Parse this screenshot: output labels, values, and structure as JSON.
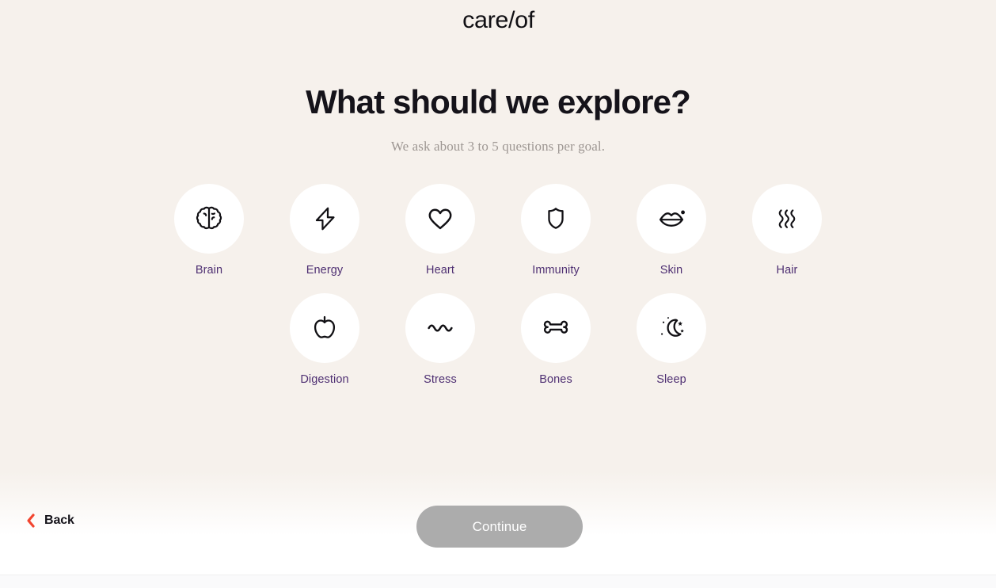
{
  "brand": {
    "logo_text": "care/of"
  },
  "header": {
    "title": "What should we explore?",
    "subtitle": "We ask about 3 to 5 questions per goal."
  },
  "goals": {
    "row1": [
      {
        "id": "brain",
        "label": "Brain",
        "icon": "brain-icon"
      },
      {
        "id": "energy",
        "label": "Energy",
        "icon": "lightning-bolt-icon"
      },
      {
        "id": "heart",
        "label": "Heart",
        "icon": "heart-icon"
      },
      {
        "id": "immunity",
        "label": "Immunity",
        "icon": "shield-icon"
      },
      {
        "id": "skin",
        "label": "Skin",
        "icon": "lips-icon"
      },
      {
        "id": "hair",
        "label": "Hair",
        "icon": "hair-waves-icon"
      }
    ],
    "row2": [
      {
        "id": "digestion",
        "label": "Digestion",
        "icon": "apple-icon"
      },
      {
        "id": "stress",
        "label": "Stress",
        "icon": "squiggle-wave-icon"
      },
      {
        "id": "bones",
        "label": "Bones",
        "icon": "bone-icon"
      },
      {
        "id": "sleep",
        "label": "Sleep",
        "icon": "moon-stars-icon"
      }
    ]
  },
  "footer": {
    "back_label": "Back",
    "continue_label": "Continue"
  },
  "colors": {
    "background": "#F6F1EC",
    "card": "#FFFFFF",
    "label_purple": "#4E2F72",
    "heading": "#15131A",
    "subtitle_gray": "#9E9793",
    "back_chevron_red": "#F2452F",
    "continue_disabled": "#ACACAC",
    "continue_text": "#FFFFFF"
  }
}
